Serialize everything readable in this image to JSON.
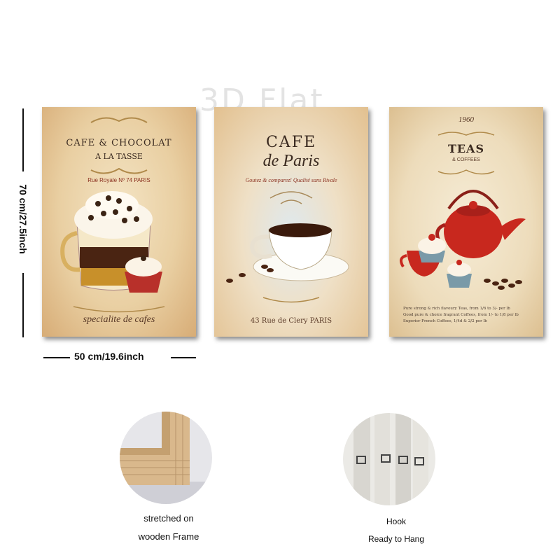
{
  "watermark": "3D Flat",
  "panels": [
    {
      "title_line1": "CAFE & CHOCOLAT",
      "title_line2": "A LA TASSE",
      "address": "Rue Royale Nº 74 PARIS",
      "footer": "specialite de cafes"
    },
    {
      "title_line1": "CAFE",
      "title_line2": "de Paris",
      "tagline": "Goutez & comparez! Qualité sans Rivale",
      "footer": "43 Rue de Clery PARIS"
    },
    {
      "year": "1960",
      "title": "TEAS",
      "subtitle": "& COFFEES",
      "menu": [
        "Pure strong & rich flavoury Teas, from 1/6 to 3/- per lb",
        "Good pure & choice fragrant Coffees, from 1/- to 1/8 per lb",
        "Superior French Coffees, 1/4d & 2/2 per lb"
      ]
    }
  ],
  "dimensions": {
    "height_label": "70 cm/27.5inch",
    "width_label": "50 cm/19.6inch"
  },
  "features": [
    {
      "caption_line1": "stretched on",
      "caption_line2": "wooden Frame"
    },
    {
      "caption_line1": "Hook",
      "caption_line2": "Ready to Hang"
    }
  ],
  "colors": {
    "teapot_red": "#c8281e",
    "coffee_brown": "#4a2412",
    "frame_wood": "#d9b88c"
  }
}
